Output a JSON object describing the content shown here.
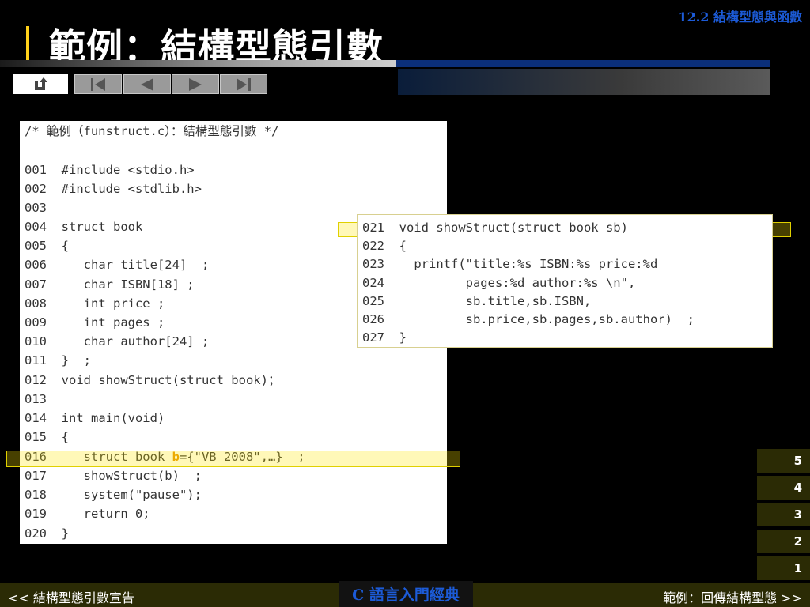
{
  "header": {
    "section_label": "12.2 結構型態與函數",
    "title": "範例：結構型態引數"
  },
  "nav": {
    "buttons": [
      {
        "name": "return-icon",
        "label": "return"
      },
      {
        "name": "first-slide-icon",
        "label": "first"
      },
      {
        "name": "previous-slide-icon",
        "label": "previous"
      },
      {
        "name": "next-slide-icon",
        "label": "next"
      },
      {
        "name": "last-slide-icon",
        "label": "last"
      }
    ]
  },
  "code": {
    "lines": [
      "/* 範例（funstruct.c）：結構型態引數 */",
      "",
      "001  #include <stdio.h>",
      "002  #include <stdlib.h>",
      "003",
      "004  struct book",
      "005  {",
      "006     char title[24]  ;",
      "007     char ISBN[18] ;",
      "008     int price ;",
      "009     int pages ;",
      "010     char author[24] ;",
      "011  }  ;",
      "012  void showStruct(struct book)；",
      "013",
      "014  int main(void)",
      "015  {",
      "016     struct book ",
      "017     showStruct(b)  ;",
      "018     system(\"pause\");",
      "019     return 0;",
      "020  }"
    ],
    "line16_var": "b",
    "line16_rest": "={\"VB 2008\",…}  ;"
  },
  "detail": {
    "lines": [
      "021  void showStruct(struct book sb)",
      "022  {",
      "023    printf(\"title:%s ISBN:%s price:%d",
      "024           pages:%d author:%s \\n\",",
      "025           sb.title,sb.ISBN,",
      "026           sb.price,sb.pages,sb.author)  ;",
      "027  }"
    ]
  },
  "page_tabs": [
    "5",
    "4",
    "3",
    "2",
    "1"
  ],
  "footer": {
    "prev_link": "<< 結構型態引數宣告",
    "book_title": "C 語言入門經典",
    "next_link": "範例：回傳結構型態 >>"
  }
}
